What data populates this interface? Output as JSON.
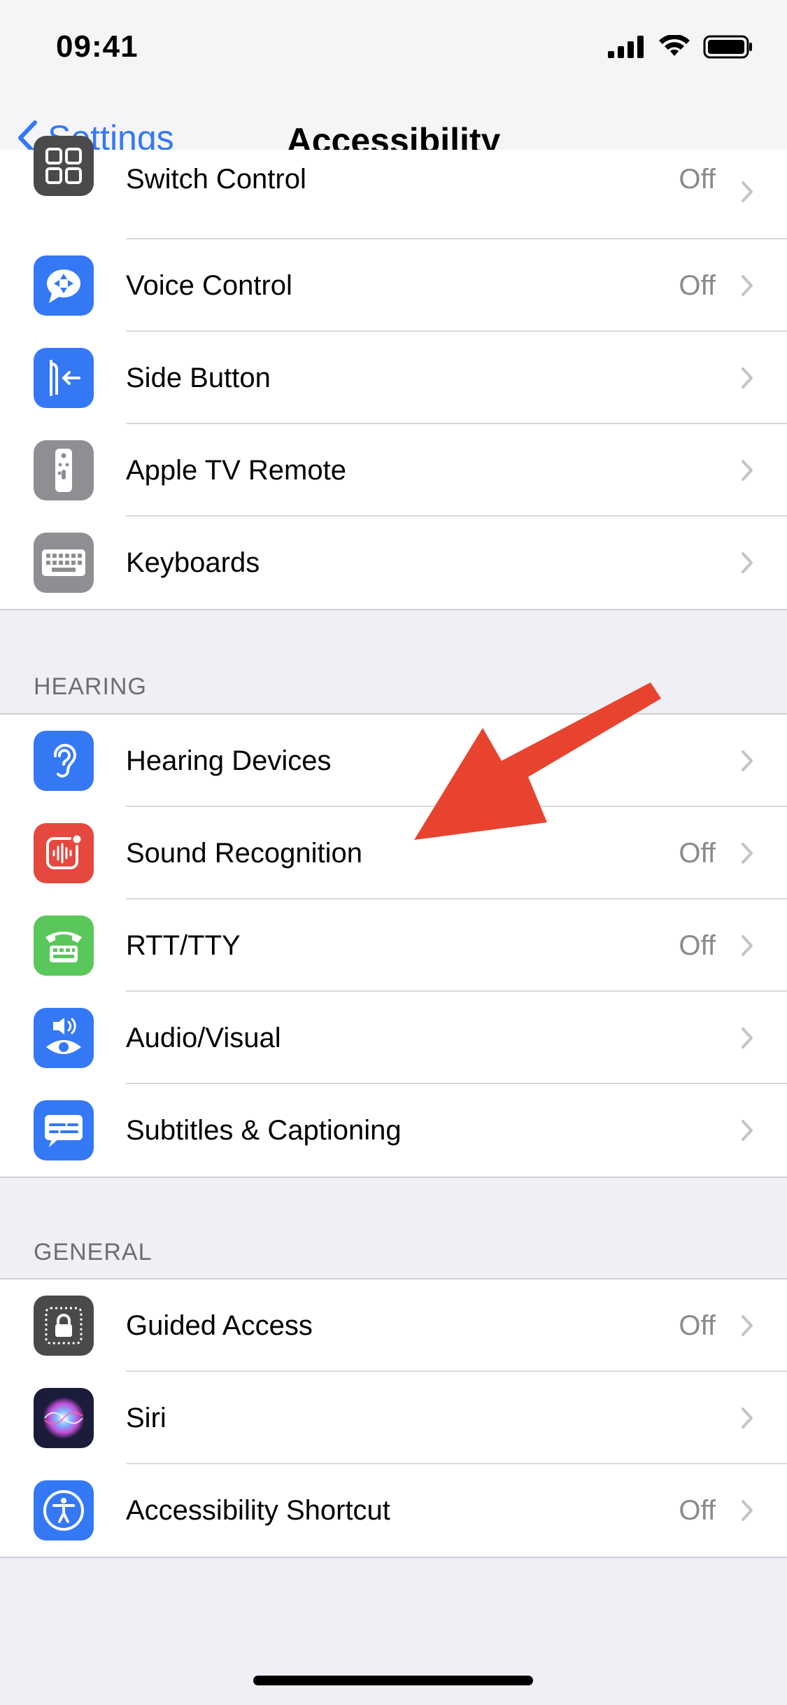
{
  "status": {
    "time": "09:41"
  },
  "nav": {
    "back_label": "Settings",
    "title": "Accessibility"
  },
  "sections": [
    {
      "header": "",
      "rows": [
        {
          "label": "Switch Control",
          "value": "Off",
          "icon": "switch-control-icon",
          "color": "#4a4a4c"
        },
        {
          "label": "Voice Control",
          "value": "Off",
          "icon": "voice-control-icon",
          "color": "#3478f6"
        },
        {
          "label": "Side Button",
          "value": "",
          "icon": "side-button-icon",
          "color": "#3478f6"
        },
        {
          "label": "Apple TV Remote",
          "value": "",
          "icon": "tv-remote-icon",
          "color": "#8e8e93"
        },
        {
          "label": "Keyboards",
          "value": "",
          "icon": "keyboard-icon",
          "color": "#8e8e93"
        }
      ]
    },
    {
      "header": "HEARING",
      "rows": [
        {
          "label": "Hearing Devices",
          "value": "",
          "icon": "ear-icon",
          "color": "#3478f6"
        },
        {
          "label": "Sound Recognition",
          "value": "Off",
          "icon": "sound-recognition-icon",
          "color": "#e5483f"
        },
        {
          "label": "RTT/TTY",
          "value": "Off",
          "icon": "tty-icon",
          "color": "#5ac75a"
        },
        {
          "label": "Audio/Visual",
          "value": "",
          "icon": "audio-visual-icon",
          "color": "#3478f6"
        },
        {
          "label": "Subtitles & Captioning",
          "value": "",
          "icon": "captions-icon",
          "color": "#3478f6"
        }
      ]
    },
    {
      "header": "GENERAL",
      "rows": [
        {
          "label": "Guided Access",
          "value": "Off",
          "icon": "guided-access-icon",
          "color": "#4a4a4c"
        },
        {
          "label": "Siri",
          "value": "",
          "icon": "siri-icon",
          "color": "#1b1b3a"
        },
        {
          "label": "Accessibility Shortcut",
          "value": "Off",
          "icon": "accessibility-icon",
          "color": "#3478f6"
        }
      ]
    }
  ],
  "annotation_color": "#e8432f"
}
